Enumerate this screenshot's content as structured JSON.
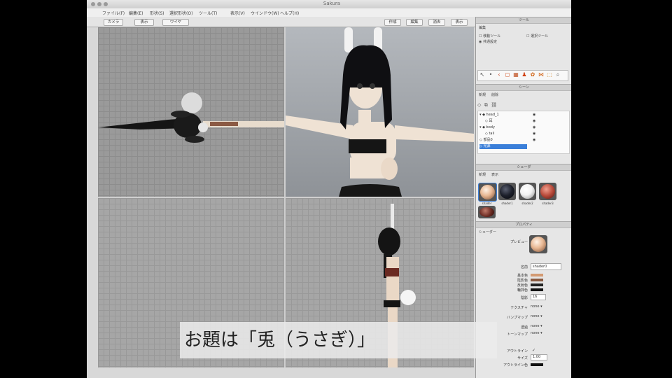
{
  "window": {
    "title": "Sakura",
    "traffic_lights": [
      "close",
      "minimize",
      "zoom"
    ]
  },
  "menu": [
    {
      "label": "ファイル(F)"
    },
    {
      "label": "編集(E)"
    },
    {
      "label": "形状(S)"
    },
    {
      "label": "選択形状(O)"
    },
    {
      "label": "ツール(T)"
    },
    {
      "label": "表示(V)"
    },
    {
      "label": "ウインドウ(W)"
    },
    {
      "label": "ヘルプ(H)"
    }
  ],
  "toolbar": {
    "left": [
      "カメラ",
      "表示",
      "ワイヤ"
    ],
    "right": [
      "作成",
      "編集",
      "消去",
      "表示"
    ]
  },
  "viewports": [
    {
      "name": "top-view"
    },
    {
      "name": "perspective-view"
    },
    {
      "name": "front-view"
    },
    {
      "name": "side-view"
    }
  ],
  "panels": {
    "tools_header": "ツール",
    "tools_options": [
      "編集",
      "移動ツール",
      "選択ツール",
      "共通設定"
    ],
    "scene_header": "シーン",
    "scene_tabs": [
      "新規",
      "削除"
    ],
    "scene_items": [
      {
        "label": "head_1",
        "selected": false
      },
      {
        "label": "耳",
        "selected": false
      },
      {
        "label": "body",
        "selected": false
      },
      {
        "label": "tail",
        "selected": false
      },
      {
        "label": "部品0",
        "selected": false
      },
      {
        "label": "光源",
        "selected": true
      }
    ],
    "shader_header": "シェーダ",
    "shader_tabs": [
      "新規",
      "表示"
    ],
    "shaders": [
      {
        "label": "shader",
        "color": "#e8b894"
      },
      {
        "label": "shader1",
        "color": "#1c1f2a"
      },
      {
        "label": "shader2",
        "color": "#f2f2f2"
      },
      {
        "label": "shader3",
        "color": "#b84a3a"
      }
    ],
    "properties_header": "プロパティ",
    "property_section": "シェーダー",
    "preview_label": "プレビュー",
    "name_label": "名前",
    "name_value": "shader0",
    "color_labels": [
      "基本色",
      "陰影色",
      "反射色",
      "輪郭色"
    ],
    "color_swatches": [
      "#d39a72",
      "#8a5a40",
      "#222222",
      "#111111"
    ],
    "numeric_label": "陰影",
    "numeric_value": "16",
    "dropdowns": [
      {
        "label": "テクスチャ",
        "value": "none"
      },
      {
        "label": "バンプマップ",
        "value": "none"
      },
      {
        "label": "透過",
        "value": "none"
      },
      {
        "label": "トーンマップ",
        "value": "none"
      }
    ],
    "outline_label": "アウトライン",
    "size_label": "サイズ",
    "size_value": "1.00",
    "outline_color_label": "アウトライン色"
  },
  "caption": {
    "text": "お題は「兎（うさぎ）」"
  }
}
